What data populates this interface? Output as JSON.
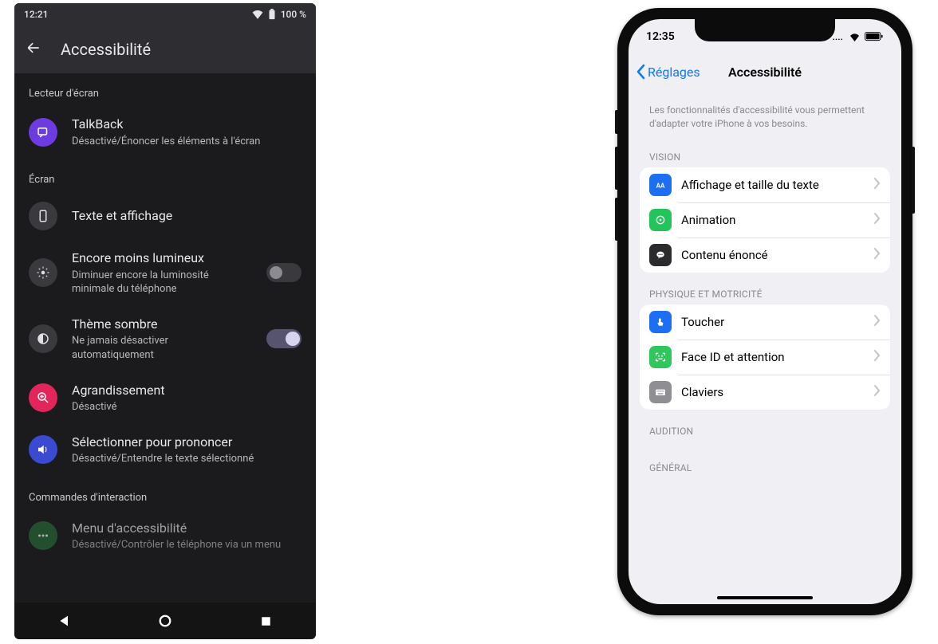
{
  "android": {
    "status": {
      "time": "12:21",
      "battery": "100 %"
    },
    "header": {
      "title": "Accessibilité"
    },
    "sections": {
      "screenReader": {
        "header": "Lecteur d'écran"
      },
      "screen": {
        "header": "Écran"
      },
      "interaction": {
        "header": "Commandes d'interaction"
      }
    },
    "rows": {
      "talkback": {
        "title": "TalkBack",
        "subtitle": "Désactivé/Énoncer les éléments à l'écran"
      },
      "textDisplay": {
        "title": "Texte et affichage"
      },
      "extraDim": {
        "title": "Encore moins lumineux",
        "subtitle": "Diminuer encore la luminosité minimale du téléphone"
      },
      "darkTheme": {
        "title": "Thème sombre",
        "subtitle": "Ne jamais désactiver automatiquement"
      },
      "magnification": {
        "title": "Agrandissement",
        "subtitle": "Désactivé"
      },
      "selectSpeak": {
        "title": "Sélectionner pour prononcer",
        "subtitle": "Désactivé/Entendre le texte sélectionné"
      },
      "a11yMenu": {
        "title": "Menu d'accessibilité",
        "subtitle": "Désactivé/Contrôler le téléphone via un menu"
      }
    }
  },
  "ios": {
    "status": {
      "time": "12:35"
    },
    "nav": {
      "back": "Réglages",
      "title": "Accessibilité"
    },
    "description": "Les fonctionnalités d'accessibilité vous permettent d'adapter votre iPhone à vos besoins.",
    "sections": {
      "vision": "VISION",
      "physical": "PHYSIQUE ET MOTRICITÉ",
      "hearing": "AUDITION",
      "general": "GÉNÉRAL"
    },
    "rows": {
      "displayText": "Affichage et taille du texte",
      "animation": "Animation",
      "spoken": "Contenu énoncé",
      "touch": "Toucher",
      "faceId": "Face ID et attention",
      "keyboards": "Claviers"
    }
  }
}
